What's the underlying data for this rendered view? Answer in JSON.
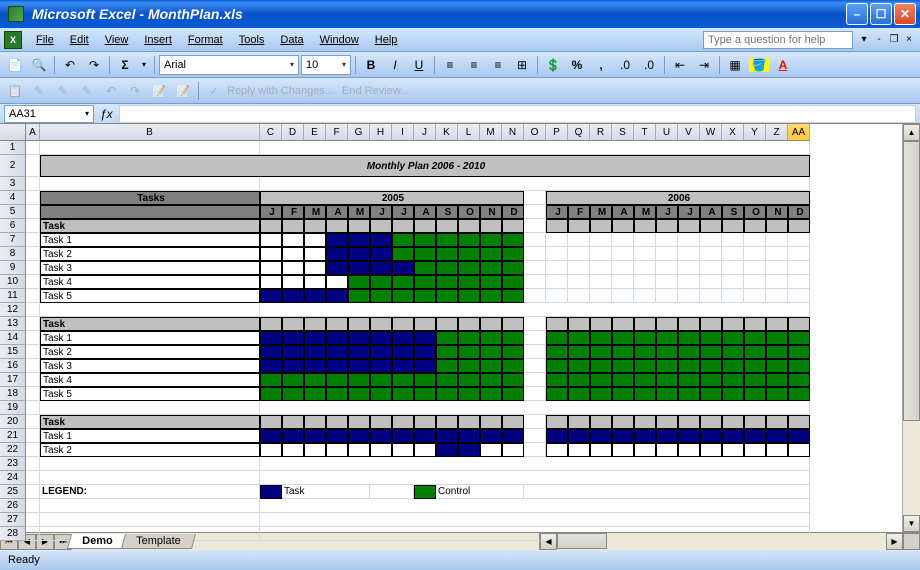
{
  "window": {
    "app": "Microsoft Excel",
    "doc": "MonthPlan.xls"
  },
  "menus": [
    "File",
    "Edit",
    "View",
    "Insert",
    "Format",
    "Tools",
    "Data",
    "Window",
    "Help"
  ],
  "help_placeholder": "Type a question for help",
  "toolbar": {
    "font": "Arial",
    "size": "10",
    "reply": "Reply with Changes...",
    "end_review": "End Review..."
  },
  "namebox": "AA31",
  "title": "Monthly Plan 2006 - 2010",
  "tasks_header": "Tasks",
  "years": [
    "2005",
    "2006"
  ],
  "months": [
    "J",
    "F",
    "M",
    "A",
    "M",
    "J",
    "J",
    "A",
    "S",
    "O",
    "N",
    "D"
  ],
  "groups": [
    {
      "header": "Task",
      "rows": [
        "Task 1",
        "Task 2",
        "Task 3",
        "Task 4",
        "Task 5"
      ]
    },
    {
      "header": "Task",
      "rows": [
        "Task 1",
        "Task 2",
        "Task 3",
        "Task 4",
        "Task 5"
      ]
    },
    {
      "header": "Task",
      "rows": [
        "Task 1",
        "Task 2"
      ]
    }
  ],
  "legend": {
    "label": "LEGEND:",
    "task": "Task",
    "control": "Control"
  },
  "tabs": [
    "Demo",
    "Template"
  ],
  "status": "Ready",
  "colors": {
    "task": "#000080",
    "control": "#008000"
  },
  "columns": [
    "A",
    "B",
    "C",
    "D",
    "E",
    "F",
    "G",
    "H",
    "I",
    "J",
    "K",
    "L",
    "M",
    "N",
    "O",
    "P",
    "Q",
    "R",
    "S",
    "T",
    "U",
    "V",
    "W",
    "X",
    "Y",
    "Z",
    "AA"
  ],
  "gantt": {
    "g1": {
      "Task 1": {
        "blue": [
          3,
          4,
          5
        ],
        "green": [
          6,
          7,
          8,
          9,
          10,
          11
        ]
      },
      "Task 2": {
        "blue": [
          3,
          4,
          5
        ],
        "green": [
          6,
          7,
          8,
          9,
          10,
          11
        ]
      },
      "Task 3": {
        "blue": [
          3,
          4,
          5,
          6
        ],
        "green": [
          7,
          8,
          9,
          10,
          11
        ]
      },
      "Task 4": {
        "blue": [],
        "green": [
          4,
          5,
          6,
          7,
          8,
          9,
          10,
          11
        ]
      },
      "Task 5": {
        "blue": [
          0,
          1,
          2,
          3
        ],
        "green": [
          4,
          5,
          6,
          7,
          8,
          9,
          10,
          11
        ]
      }
    },
    "g2": {
      "Task 1": {
        "blue": [
          0,
          1,
          2,
          3,
          4,
          5,
          6,
          7
        ],
        "green": [
          8,
          9,
          10,
          11,
          12,
          13,
          14,
          15,
          16,
          17,
          18,
          19,
          20,
          21,
          22,
          23
        ]
      },
      "Task 2": {
        "blue": [
          0,
          1,
          2,
          3,
          4,
          5,
          6,
          7
        ],
        "green": [
          8,
          9,
          10,
          11,
          12,
          13,
          14,
          15,
          16,
          17,
          18,
          19,
          20,
          21,
          22,
          23
        ]
      },
      "Task 3": {
        "blue": [
          0,
          1,
          2,
          3,
          4,
          5,
          6,
          7
        ],
        "green": [
          8,
          9,
          10,
          11,
          12,
          13,
          14,
          15,
          16,
          17,
          18,
          19,
          20,
          21,
          22,
          23
        ]
      },
      "Task 4": {
        "blue": [],
        "green": [
          0,
          1,
          2,
          3,
          4,
          5,
          6,
          7,
          8,
          9,
          10,
          11,
          12,
          13,
          14,
          15,
          16,
          17,
          18,
          19,
          20,
          21,
          22,
          23
        ]
      },
      "Task 5": {
        "blue": [],
        "green": [
          0,
          1,
          2,
          3,
          4,
          5,
          6,
          7,
          8,
          9,
          10,
          11,
          12,
          13,
          14,
          15,
          16,
          17,
          18,
          19,
          20,
          21,
          22,
          23
        ]
      }
    },
    "g3": {
      "Task 1": {
        "blue": [
          0,
          1,
          2,
          3,
          4,
          5,
          6,
          7,
          8,
          9,
          10,
          11,
          12,
          13,
          14,
          15,
          16,
          17,
          18,
          19,
          20,
          21,
          22,
          23
        ],
        "green": []
      },
      "Task 2": {
        "blue": [
          8,
          9
        ],
        "green": []
      }
    }
  }
}
